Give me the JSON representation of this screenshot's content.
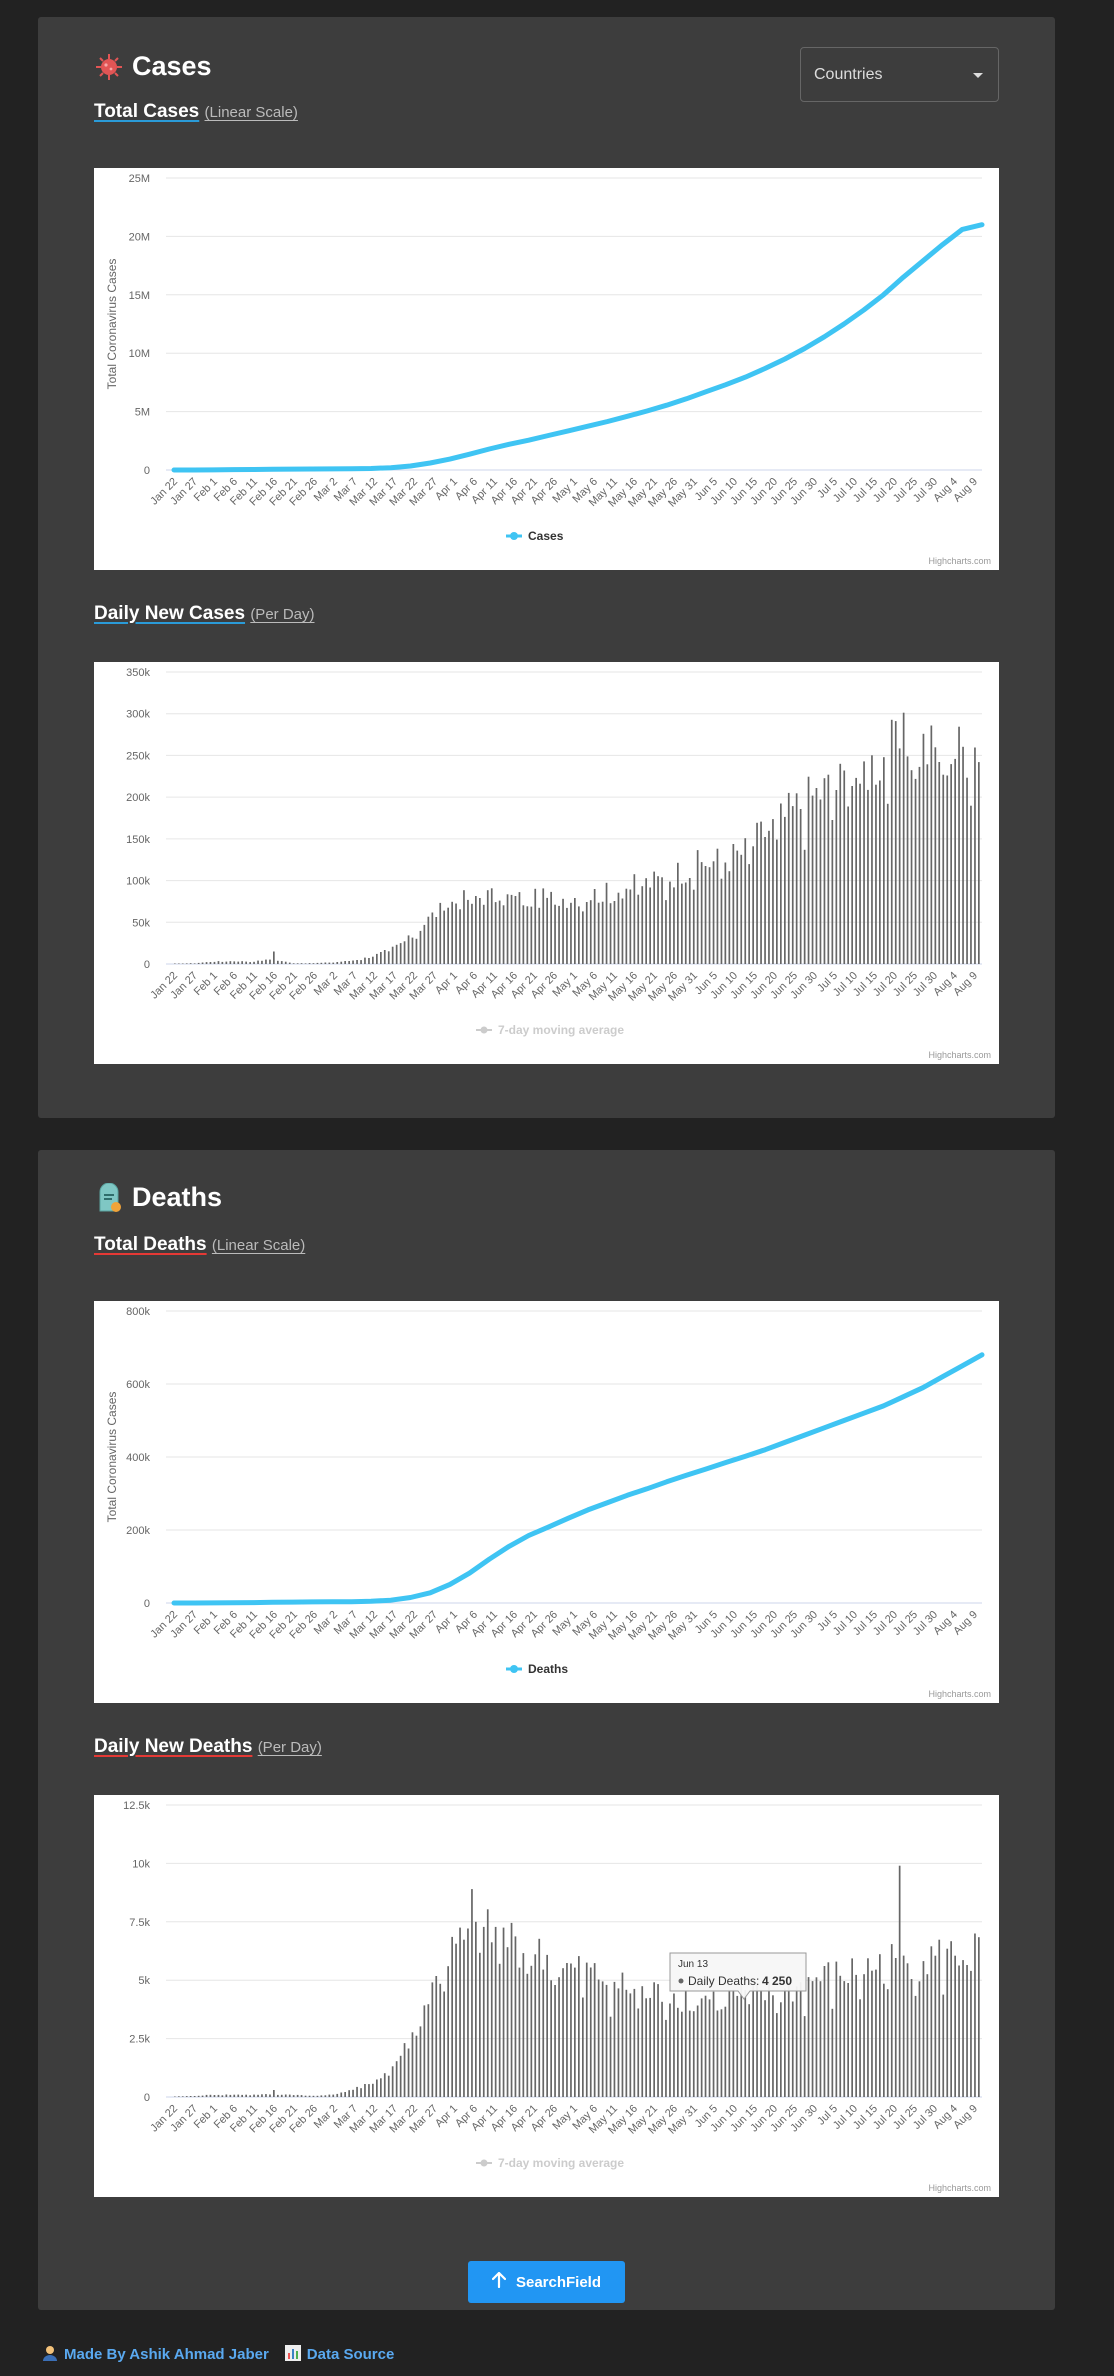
{
  "cases_section": {
    "icon": "virus-icon",
    "title": "Cases",
    "country_select": {
      "value": "Countries"
    },
    "total_title": "Total Cases",
    "total_scale": "(Linear Scale)",
    "daily_title": "Daily New Cases",
    "daily_scale": "(Per Day)"
  },
  "deaths_section": {
    "icon": "tombstone-icon",
    "title": "Deaths",
    "total_title": "Total Deaths",
    "total_scale": "(Linear Scale)",
    "daily_title": "Daily New Deaths",
    "daily_scale": "(Per Day)"
  },
  "credits": "Highcharts.com",
  "search_button": {
    "label": "SearchField",
    "icon": "arrow-up-icon"
  },
  "footer": {
    "author_icon": "person-icon",
    "author": "Made By Ashik Ahmad Jaber",
    "source_icon": "bar-chart-icon",
    "source": "Data Source"
  },
  "colors": {
    "line": "#3fc4f3",
    "bar": "#666666",
    "background": "#222222",
    "card": "#3d3d3d",
    "accent": "#2196f3"
  },
  "chart_data": [
    {
      "type": "line",
      "xlabels": [
        "Jan 22",
        "Jan 27",
        "Feb 1",
        "Feb 6",
        "Feb 11",
        "Feb 16",
        "Feb 21",
        "Feb 26",
        "Mar 2",
        "Mar 7",
        "Mar 12",
        "Mar 17",
        "Mar 22",
        "Mar 27",
        "Apr 1",
        "Apr 6",
        "Apr 11",
        "Apr 16",
        "Apr 21",
        "Apr 26",
        "May 1",
        "May 6",
        "May 11",
        "May 16",
        "May 21",
        "May 26",
        "May 31",
        "Jun 5",
        "Jun 10",
        "Jun 15",
        "Jun 20",
        "Jun 25",
        "Jun 30",
        "Jul 5",
        "Jul 10",
        "Jul 15",
        "Jul 20",
        "Jul 25",
        "Jul 30",
        "Aug 4",
        "Aug 9"
      ],
      "values": [
        0.0006,
        0.003,
        0.012,
        0.031,
        0.045,
        0.07,
        0.077,
        0.083,
        0.09,
        0.105,
        0.13,
        0.2,
        0.34,
        0.6,
        0.93,
        1.35,
        1.8,
        2.2,
        2.55,
        2.95,
        3.35,
        3.75,
        4.15,
        4.6,
        5.05,
        5.55,
        6.1,
        6.7,
        7.3,
        7.95,
        8.7,
        9.5,
        10.4,
        11.4,
        12.5,
        13.7,
        15.0,
        16.5,
        17.9,
        19.3,
        20.6,
        21.0
      ],
      "yticks": [
        "0",
        "5M",
        "10M",
        "15M",
        "20M",
        "25M"
      ],
      "ylim": [
        0,
        25
      ],
      "ylabel": "Total Coronavirus Cases",
      "legend": "Cases"
    },
    {
      "type": "bar",
      "xlabels": [
        "Jan 22",
        "Jan 27",
        "Feb 1",
        "Feb 6",
        "Feb 11",
        "Feb 16",
        "Feb 21",
        "Feb 26",
        "Mar 2",
        "Mar 7",
        "Mar 12",
        "Mar 17",
        "Mar 22",
        "Mar 27",
        "Apr 1",
        "Apr 6",
        "Apr 11",
        "Apr 16",
        "Apr 21",
        "Apr 26",
        "May 1",
        "May 6",
        "May 11",
        "May 16",
        "May 21",
        "May 26",
        "May 31",
        "Jun 5",
        "Jun 10",
        "Jun 15",
        "Jun 20",
        "Jun 25",
        "Jun 30",
        "Jul 5",
        "Jul 10",
        "Jul 15",
        "Jul 20",
        "Jul 25",
        "Jul 30",
        "Aug 4",
        "Aug 9"
      ],
      "weekly_levels_k": [
        0.5,
        1,
        3,
        3.5,
        3,
        6,
        1,
        1,
        2,
        4,
        9,
        18,
        32,
        58,
        75,
        82,
        85,
        82,
        80,
        82,
        82,
        85,
        88,
        95,
        100,
        105,
        118,
        125,
        130,
        138,
        162,
        180,
        200,
        215,
        225,
        240,
        255,
        270,
        270,
        262,
        265,
        275
      ],
      "yticks": [
        "0",
        "50k",
        "100k",
        "150k",
        "200k",
        "250k",
        "300k",
        "350k"
      ],
      "ylim": [
        0,
        350
      ],
      "legend": "7-day moving average"
    },
    {
      "type": "line",
      "xlabels": [
        "Jan 22",
        "Jan 27",
        "Feb 1",
        "Feb 6",
        "Feb 11",
        "Feb 16",
        "Feb 21",
        "Feb 26",
        "Mar 2",
        "Mar 7",
        "Mar 12",
        "Mar 17",
        "Mar 22",
        "Mar 27",
        "Apr 1",
        "Apr 6",
        "Apr 11",
        "Apr 16",
        "Apr 21",
        "Apr 26",
        "May 1",
        "May 6",
        "May 11",
        "May 16",
        "May 21",
        "May 26",
        "May 31",
        "Jun 5",
        "Jun 10",
        "Jun 15",
        "Jun 20",
        "Jun 25",
        "Jun 30",
        "Jul 5",
        "Jul 10",
        "Jul 15",
        "Jul 20",
        "Jul 25",
        "Jul 30",
        "Aug 4",
        "Aug 9"
      ],
      "values": [
        0.02,
        0.1,
        0.3,
        0.6,
        1.1,
        1.8,
        2.4,
        2.9,
        3.2,
        3.6,
        4.6,
        7.8,
        15,
        28,
        51,
        82,
        120,
        155,
        185,
        208,
        232,
        255,
        275,
        295,
        313,
        332,
        350,
        367,
        385,
        402,
        420,
        440,
        460,
        480,
        500,
        520,
        540,
        565,
        590,
        620,
        650,
        680
      ],
      "yticks": [
        "0",
        "200k",
        "400k",
        "600k",
        "800k"
      ],
      "ylim": [
        0,
        800
      ],
      "ylabel": "Total Coronavirus Cases",
      "legend": "Deaths"
    },
    {
      "type": "bar",
      "xlabels": [
        "Jan 22",
        "Jan 27",
        "Feb 1",
        "Feb 6",
        "Feb 11",
        "Feb 16",
        "Feb 21",
        "Feb 26",
        "Mar 2",
        "Mar 7",
        "Mar 12",
        "Mar 17",
        "Mar 22",
        "Mar 27",
        "Apr 1",
        "Apr 6",
        "Apr 11",
        "Apr 16",
        "Apr 21",
        "Apr 26",
        "May 1",
        "May 6",
        "May 11",
        "May 16",
        "May 21",
        "May 26",
        "May 31",
        "Jun 5",
        "Jun 10",
        "Jun 15",
        "Jun 20",
        "Jun 25",
        "Jun 30",
        "Jul 5",
        "Jul 10",
        "Jul 15",
        "Jul 20",
        "Jul 25",
        "Jul 30",
        "Aug 4",
        "Aug 9"
      ],
      "weekly_levels_k": [
        0.02,
        0.05,
        0.1,
        0.1,
        0.1,
        0.12,
        0.1,
        0.05,
        0.1,
        0.3,
        0.6,
        1.2,
        2.5,
        4.5,
        6.3,
        7.0,
        7.2,
        7.0,
        6.5,
        6.0,
        5.6,
        5.5,
        5.2,
        4.8,
        4.5,
        4.6,
        4.4,
        4.4,
        4.3,
        4.6,
        4.5,
        4.6,
        4.9,
        5.3,
        5.3,
        5.6,
        5.8,
        6.1,
        6.0,
        6.2,
        6.3,
        6.4
      ],
      "yticks": [
        "0",
        "2.5k",
        "5k",
        "7.5k",
        "10k",
        "12.5k"
      ],
      "ylim": [
        0,
        12.5
      ],
      "legend": "7-day moving average",
      "tooltip": {
        "date": "Jun 13",
        "label": "Daily Deaths:",
        "value": "4 250"
      }
    }
  ]
}
